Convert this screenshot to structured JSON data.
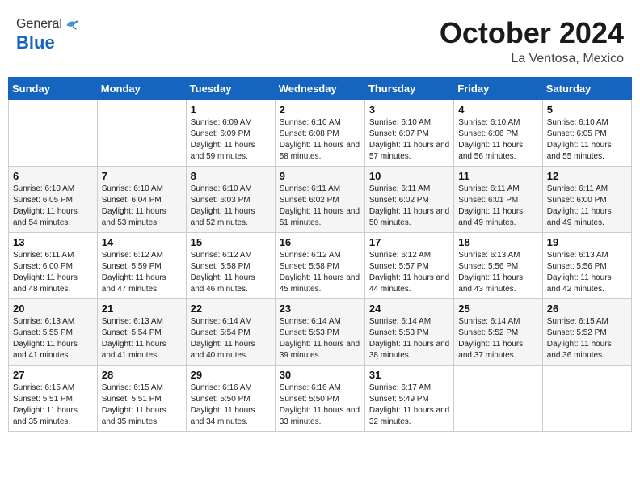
{
  "header": {
    "logo": {
      "general": "General",
      "blue": "Blue"
    },
    "title": "October 2024",
    "location": "La Ventosa, Mexico"
  },
  "weekdays": [
    "Sunday",
    "Monday",
    "Tuesday",
    "Wednesday",
    "Thursday",
    "Friday",
    "Saturday"
  ],
  "weeks": [
    [
      {
        "day": "",
        "info": ""
      },
      {
        "day": "",
        "info": ""
      },
      {
        "day": "1",
        "info": "Sunrise: 6:09 AM\nSunset: 6:09 PM\nDaylight: 11 hours and 59 minutes."
      },
      {
        "day": "2",
        "info": "Sunrise: 6:10 AM\nSunset: 6:08 PM\nDaylight: 11 hours and 58 minutes."
      },
      {
        "day": "3",
        "info": "Sunrise: 6:10 AM\nSunset: 6:07 PM\nDaylight: 11 hours and 57 minutes."
      },
      {
        "day": "4",
        "info": "Sunrise: 6:10 AM\nSunset: 6:06 PM\nDaylight: 11 hours and 56 minutes."
      },
      {
        "day": "5",
        "info": "Sunrise: 6:10 AM\nSunset: 6:05 PM\nDaylight: 11 hours and 55 minutes."
      }
    ],
    [
      {
        "day": "6",
        "info": "Sunrise: 6:10 AM\nSunset: 6:05 PM\nDaylight: 11 hours and 54 minutes."
      },
      {
        "day": "7",
        "info": "Sunrise: 6:10 AM\nSunset: 6:04 PM\nDaylight: 11 hours and 53 minutes."
      },
      {
        "day": "8",
        "info": "Sunrise: 6:10 AM\nSunset: 6:03 PM\nDaylight: 11 hours and 52 minutes."
      },
      {
        "day": "9",
        "info": "Sunrise: 6:11 AM\nSunset: 6:02 PM\nDaylight: 11 hours and 51 minutes."
      },
      {
        "day": "10",
        "info": "Sunrise: 6:11 AM\nSunset: 6:02 PM\nDaylight: 11 hours and 50 minutes."
      },
      {
        "day": "11",
        "info": "Sunrise: 6:11 AM\nSunset: 6:01 PM\nDaylight: 11 hours and 49 minutes."
      },
      {
        "day": "12",
        "info": "Sunrise: 6:11 AM\nSunset: 6:00 PM\nDaylight: 11 hours and 49 minutes."
      }
    ],
    [
      {
        "day": "13",
        "info": "Sunrise: 6:11 AM\nSunset: 6:00 PM\nDaylight: 11 hours and 48 minutes."
      },
      {
        "day": "14",
        "info": "Sunrise: 6:12 AM\nSunset: 5:59 PM\nDaylight: 11 hours and 47 minutes."
      },
      {
        "day": "15",
        "info": "Sunrise: 6:12 AM\nSunset: 5:58 PM\nDaylight: 11 hours and 46 minutes."
      },
      {
        "day": "16",
        "info": "Sunrise: 6:12 AM\nSunset: 5:58 PM\nDaylight: 11 hours and 45 minutes."
      },
      {
        "day": "17",
        "info": "Sunrise: 6:12 AM\nSunset: 5:57 PM\nDaylight: 11 hours and 44 minutes."
      },
      {
        "day": "18",
        "info": "Sunrise: 6:13 AM\nSunset: 5:56 PM\nDaylight: 11 hours and 43 minutes."
      },
      {
        "day": "19",
        "info": "Sunrise: 6:13 AM\nSunset: 5:56 PM\nDaylight: 11 hours and 42 minutes."
      }
    ],
    [
      {
        "day": "20",
        "info": "Sunrise: 6:13 AM\nSunset: 5:55 PM\nDaylight: 11 hours and 41 minutes."
      },
      {
        "day": "21",
        "info": "Sunrise: 6:13 AM\nSunset: 5:54 PM\nDaylight: 11 hours and 41 minutes."
      },
      {
        "day": "22",
        "info": "Sunrise: 6:14 AM\nSunset: 5:54 PM\nDaylight: 11 hours and 40 minutes."
      },
      {
        "day": "23",
        "info": "Sunrise: 6:14 AM\nSunset: 5:53 PM\nDaylight: 11 hours and 39 minutes."
      },
      {
        "day": "24",
        "info": "Sunrise: 6:14 AM\nSunset: 5:53 PM\nDaylight: 11 hours and 38 minutes."
      },
      {
        "day": "25",
        "info": "Sunrise: 6:14 AM\nSunset: 5:52 PM\nDaylight: 11 hours and 37 minutes."
      },
      {
        "day": "26",
        "info": "Sunrise: 6:15 AM\nSunset: 5:52 PM\nDaylight: 11 hours and 36 minutes."
      }
    ],
    [
      {
        "day": "27",
        "info": "Sunrise: 6:15 AM\nSunset: 5:51 PM\nDaylight: 11 hours and 35 minutes."
      },
      {
        "day": "28",
        "info": "Sunrise: 6:15 AM\nSunset: 5:51 PM\nDaylight: 11 hours and 35 minutes."
      },
      {
        "day": "29",
        "info": "Sunrise: 6:16 AM\nSunset: 5:50 PM\nDaylight: 11 hours and 34 minutes."
      },
      {
        "day": "30",
        "info": "Sunrise: 6:16 AM\nSunset: 5:50 PM\nDaylight: 11 hours and 33 minutes."
      },
      {
        "day": "31",
        "info": "Sunrise: 6:17 AM\nSunset: 5:49 PM\nDaylight: 11 hours and 32 minutes."
      },
      {
        "day": "",
        "info": ""
      },
      {
        "day": "",
        "info": ""
      }
    ]
  ]
}
